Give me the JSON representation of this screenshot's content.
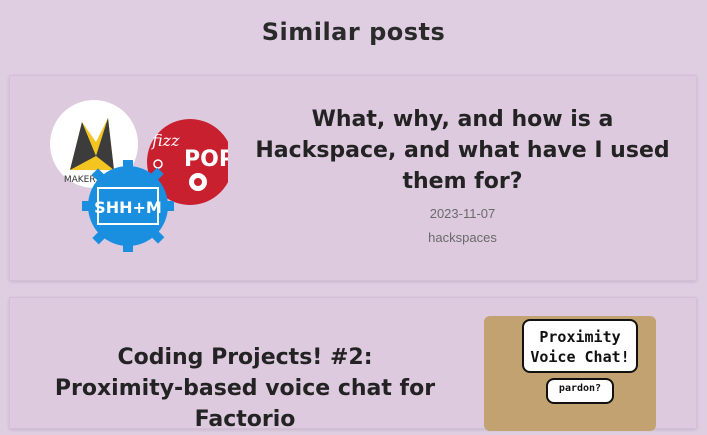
{
  "section": {
    "heading": "Similar posts"
  },
  "posts": [
    {
      "title": "What, why, and how is a Hackspace, and what have I used them for?",
      "date": "2023-11-07",
      "tag": "hackspaces",
      "logos": {
        "makerspace": "MAKERSPACE",
        "fizzpop_small": "fizz",
        "fizzpop_big": "POP",
        "shhm": "SHH+M"
      }
    },
    {
      "title": "Coding Projects! #2: Proximity-based voice chat for Factorio",
      "thumbnail": {
        "bubble_main": "Proximity Voice Chat!",
        "bubble_small": "pardon?"
      }
    }
  ],
  "colors": {
    "background": "#dfcde2",
    "card": "#ddcadf",
    "fizzpop": "#c8202f",
    "shhm": "#1a8fe0",
    "makerspace": "#f4c520"
  }
}
